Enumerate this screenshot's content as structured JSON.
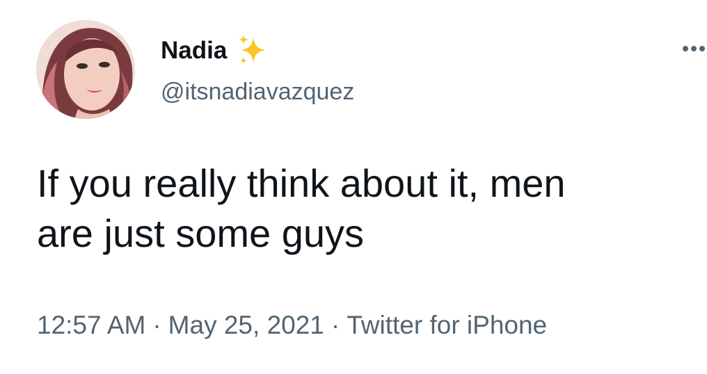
{
  "tweet": {
    "author": {
      "display_name": "Nadia",
      "handle": "@itsnadiavazquez",
      "name_emoji": "sparkles-icon",
      "avatar": "avatar"
    },
    "text_line1": "If you really think about it, men",
    "text_line2": "are just some guys",
    "time": "12:57 AM",
    "separator": "·",
    "date": "May 25, 2021",
    "source": "Twitter for iPhone",
    "more_icon": "more-horizontal-icon"
  },
  "colors": {
    "text": "#0f1419",
    "secondary": "#536471",
    "sparkle": "#f9c623"
  }
}
